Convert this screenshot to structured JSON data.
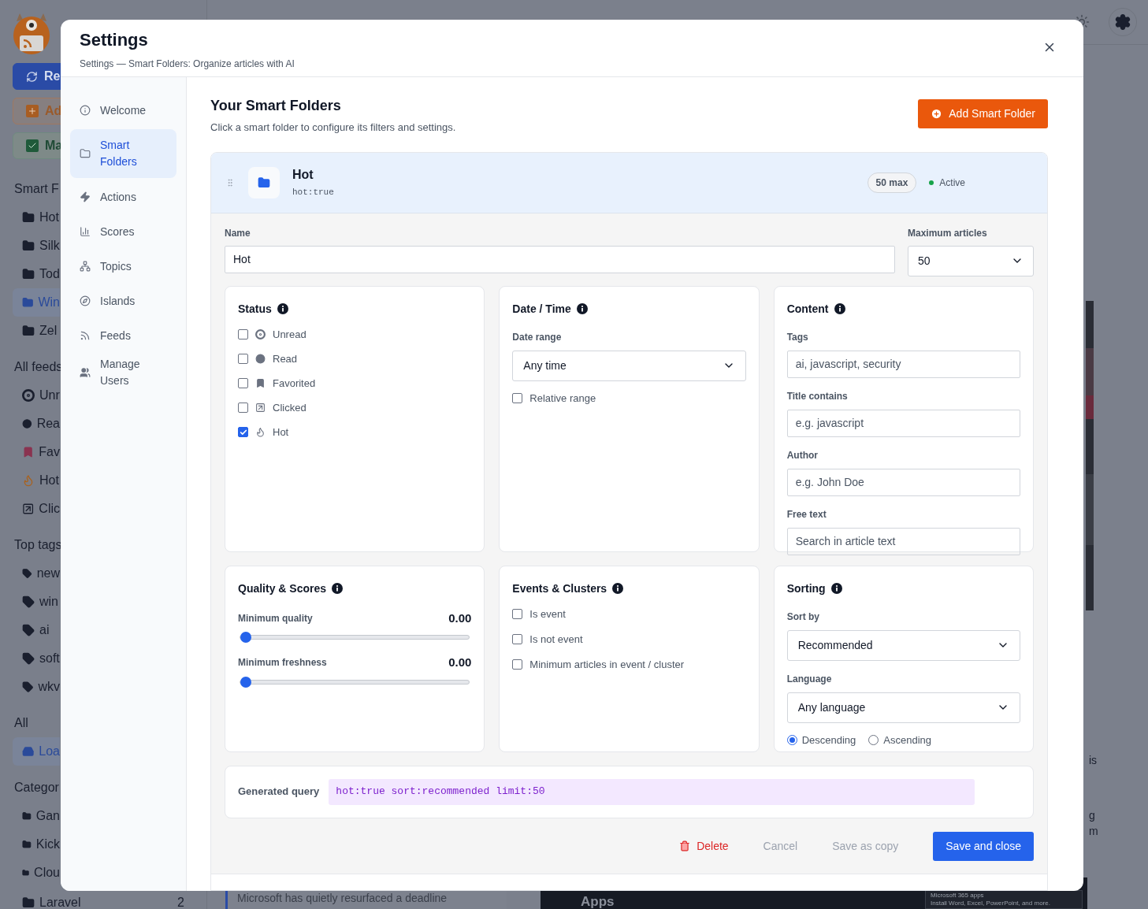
{
  "background": {
    "buttons": [
      {
        "kind": "reload",
        "label": "Re"
      },
      {
        "kind": "add",
        "label": "Ad"
      },
      {
        "kind": "mark",
        "label": "Ma"
      }
    ],
    "sections": [
      {
        "title": "Smart F",
        "items": [
          {
            "kind": "folder",
            "label": "Hot",
            "selected": false
          },
          {
            "kind": "folder",
            "label": "Silk",
            "selected": false
          },
          {
            "kind": "folder",
            "label": "Tod",
            "selected": false
          },
          {
            "kind": "folder",
            "label": "Win",
            "selected": true
          },
          {
            "kind": "folder",
            "label": "Zel",
            "selected": false
          }
        ]
      },
      {
        "title": "All feeds",
        "items": [
          {
            "kind": "unread",
            "label": "Unr",
            "selected": false
          },
          {
            "kind": "read",
            "label": "Rea",
            "selected": false
          },
          {
            "kind": "favorite",
            "label": "Fav",
            "selected": false
          },
          {
            "kind": "hot",
            "label": "Hot",
            "selected": false
          },
          {
            "kind": "clicked",
            "label": "Clic",
            "selected": false
          }
        ]
      },
      {
        "title": "Top tags",
        "items": [
          {
            "kind": "tag",
            "label": "new",
            "selected": false
          },
          {
            "kind": "tag",
            "label": "win",
            "selected": false
          },
          {
            "kind": "tag",
            "label": "ai",
            "selected": false
          },
          {
            "kind": "tag",
            "label": "soft",
            "selected": false
          },
          {
            "kind": "tag",
            "label": "wkv",
            "selected": false
          }
        ]
      },
      {
        "title": "All",
        "items": [
          {
            "kind": "inbox",
            "label": "Loa",
            "selected": true
          }
        ]
      },
      {
        "title": "Categor",
        "items": [
          {
            "kind": "folder",
            "label": "Gan",
            "selected": false
          },
          {
            "kind": "folder",
            "label": "Kick",
            "selected": false
          },
          {
            "kind": "folder",
            "label": "Clou",
            "selected": false
          }
        ]
      }
    ],
    "last_category": {
      "label": "Laravel",
      "count": "2"
    },
    "article_snippet": "Microsoft has quietly resurfaced a deadline",
    "image_title": "Apps",
    "promo_title": "Microsoft 365 apps",
    "promo_text": "Install Word, Excel, PowerPoint, and more.",
    "side_fragments": [
      "is",
      "g",
      "m"
    ]
  },
  "settings": {
    "title": "Settings",
    "subtitle": "Settings — Smart Folders: Organize articles with AI",
    "nav": [
      {
        "label": "Welcome",
        "selected": false
      },
      {
        "label": "Smart Folders",
        "selected": true
      },
      {
        "label": "Actions",
        "selected": false
      },
      {
        "label": "Scores",
        "selected": false
      },
      {
        "label": "Topics",
        "selected": false
      },
      {
        "label": "Islands",
        "selected": false
      },
      {
        "label": "Feeds",
        "selected": false
      },
      {
        "label": "Manage Users",
        "selected": false
      }
    ],
    "heading": "Your Smart Folders",
    "description": "Click a smart folder to configure its filters and settings.",
    "add_button": "Add Smart Folder",
    "folder": {
      "name": "Hot",
      "query": "hot:true",
      "limit_badge": "50 max",
      "status": "Active",
      "active": true,
      "name_label": "Name",
      "name_value": "Hot",
      "max_label": "Maximum articles",
      "max_value": "50",
      "panels": [
        {
          "kind": "status",
          "title": "Status",
          "items": [
            {
              "label": "Unread",
              "checked": false
            },
            {
              "label": "Read",
              "checked": false
            },
            {
              "label": "Favorited",
              "checked": false
            },
            {
              "label": "Clicked",
              "checked": false
            },
            {
              "label": "Hot",
              "checked": true
            }
          ]
        },
        {
          "kind": "form",
          "title": "Date / Time",
          "rows": [
            {
              "kind": "select",
              "label": "Date range",
              "value": "Any time"
            },
            {
              "kind": "checkbox",
              "label": "Relative range",
              "checked": false
            }
          ]
        },
        {
          "kind": "form",
          "title": "Content",
          "rows": [
            {
              "kind": "field",
              "label": "Tags",
              "placeholder": "ai, javascript, security"
            },
            {
              "kind": "field",
              "label": "Title contains",
              "placeholder": "e.g. javascript"
            },
            {
              "kind": "field",
              "label": "Author",
              "placeholder": "e.g. John Doe"
            },
            {
              "kind": "field",
              "label": "Free text",
              "placeholder": "Search in article text"
            }
          ]
        },
        {
          "kind": "form",
          "title": "Quality & Scores",
          "rows": [
            {
              "kind": "slider",
              "label": "Minimum quality",
              "reading": "0.00",
              "level": 0
            },
            {
              "kind": "slider",
              "label": "Minimum freshness",
              "reading": "0.00",
              "level": 0
            }
          ]
        },
        {
          "kind": "form",
          "title": "Events & Clusters",
          "rows": [
            {
              "kind": "checkbox",
              "label": "Is event",
              "checked": false
            },
            {
              "kind": "checkbox",
              "label": "Is not event",
              "checked": false
            },
            {
              "kind": "checkbox",
              "label": "Minimum articles in event / cluster",
              "checked": false
            }
          ]
        },
        {
          "kind": "form",
          "title": "Sorting",
          "rows": [
            {
              "kind": "select",
              "label": "Sort by",
              "value": "Recommended"
            },
            {
              "kind": "select",
              "label": "Language",
              "value": "Any language"
            },
            {
              "kind": "radios",
              "options": [
                {
                  "label": "Descending",
                  "selected": true
                },
                {
                  "label": "Ascending",
                  "selected": false
                }
              ]
            }
          ]
        }
      ],
      "query_label": "Generated query",
      "query_value": "hot:true sort:recommended limit:50",
      "actions": [
        {
          "kind": "delete",
          "label": "Delete"
        },
        {
          "kind": "plain",
          "label": "Cancel"
        },
        {
          "kind": "plain",
          "label": "Save as copy"
        },
        {
          "kind": "primary",
          "label": "Save and close"
        }
      ]
    }
  }
}
